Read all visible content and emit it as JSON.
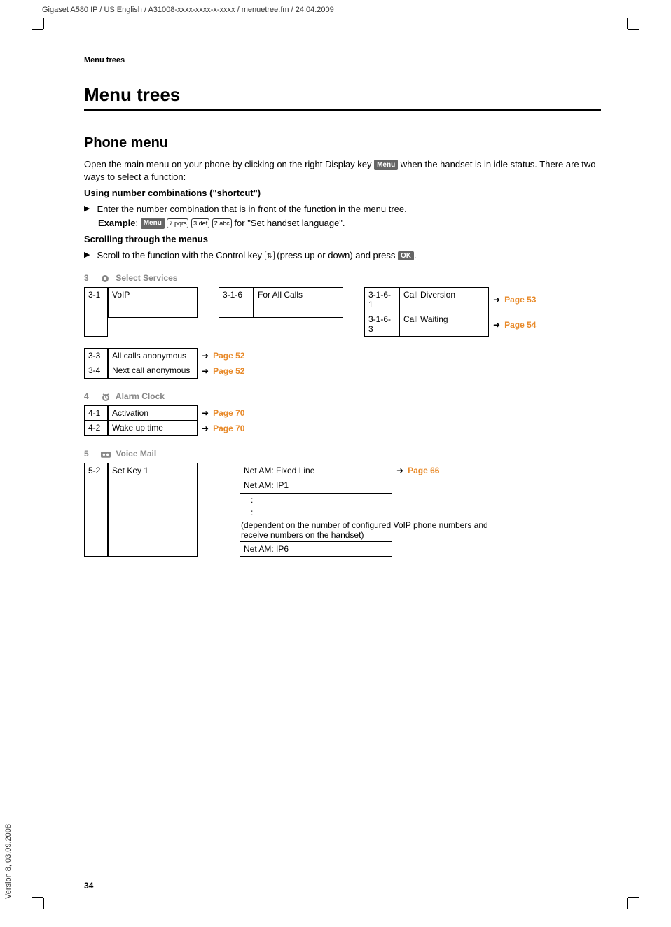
{
  "header": "Gigaset A580 IP / US English / A31008-xxxx-xxxx-x-xxxx / menuetree.fm / 24.04.2009",
  "sectionLabel": "Menu trees",
  "mainHeading": "Menu trees",
  "subHeading": "Phone menu",
  "intro1a": "Open the main menu on your phone by clicking on the right Display key ",
  "intro1b": " when the handset is in idle status. There are two ways to select a function:",
  "menuKey": "Menu",
  "shortcutHeading": "Using number combinations (\"shortcut\")",
  "bullet1": "Enter the number combination that is in front of the function in the menu tree.",
  "exampleLabel": "Example",
  "key7": "7 pqrs",
  "key3": "3 def",
  "key2": "2 abc",
  "exampleTail": " for \"Set handset language\".",
  "scrollHeading": "Scrolling through the menus",
  "bullet2a": "Scroll to the function with the Control key ",
  "bullet2b": " (press up or down) and press ",
  "bullet2c": ".",
  "okKey": "OK",
  "controlKeyGlyph": "⇅",
  "section3": {
    "num": "3",
    "title": "Select Services"
  },
  "r31": {
    "idx": "3-1",
    "label": "VoIP"
  },
  "r316": {
    "idx": "3-1-6",
    "label": "For All Calls"
  },
  "r3161": {
    "idx": "3-1-6-1",
    "label": "Call Diversion",
    "page": "Page 53"
  },
  "r3163": {
    "idx": "3-1-6-3",
    "label": "Call Waiting",
    "page": "Page 54"
  },
  "r33": {
    "idx": "3-3",
    "label": "All calls anonymous",
    "page": "Page 52"
  },
  "r34": {
    "idx": "3-4",
    "label": "Next call anonymous",
    "page": "Page 52"
  },
  "section4": {
    "num": "4",
    "title": "Alarm Clock"
  },
  "r41": {
    "idx": "4-1",
    "label": "Activation",
    "page": "Page 70"
  },
  "r42": {
    "idx": "4-2",
    "label": "Wake up time",
    "page": "Page 70"
  },
  "section5": {
    "num": "5",
    "title": "Voice Mail"
  },
  "r52": {
    "idx": "5-2",
    "label": "Set Key 1"
  },
  "r52a": {
    "label": "Net AM: Fixed Line",
    "page": "Page 66"
  },
  "r52b": {
    "label": "Net AM: IP1"
  },
  "r52note": "(dependent on the number of configured VoIP phone numbers and receive numbers on the handset)",
  "r52c": {
    "label": "Net AM: IP6"
  },
  "colon": ":",
  "arrow": "➜",
  "bulletMarker": "▶",
  "pageNumber": "34",
  "versionText": "Version 8, 03.09.2008"
}
